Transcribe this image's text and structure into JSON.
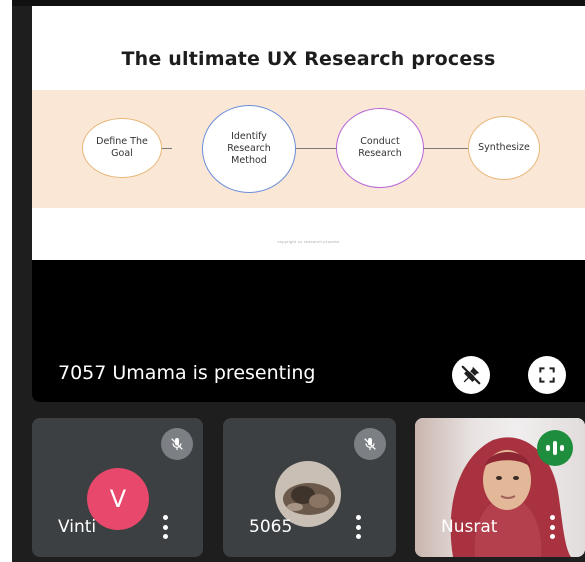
{
  "slide": {
    "title": "The ultimate UX Research process",
    "steps": [
      {
        "label": "Define The Goal",
        "color": "#e6b87a"
      },
      {
        "label": "Identify Research Method",
        "color": "#6a8fd8"
      },
      {
        "label": "Conduct Research",
        "color": "#b565d6"
      },
      {
        "label": "Synthesize",
        "color": "#e6b87a"
      }
    ],
    "footnote": "copyright ux research process"
  },
  "presenter": {
    "status_text": "7057 Umama is presenting"
  },
  "controls": {
    "unpin_icon": "pin-off-icon",
    "fullscreen_icon": "fullscreen-icon"
  },
  "participants": [
    {
      "name": "Vinti",
      "avatar_letter": "V",
      "avatar_color": "#e8486b",
      "muted": true
    },
    {
      "name": "5065",
      "avatar_type": "photo",
      "muted": true
    },
    {
      "name": "Nusrat",
      "avatar_type": "video",
      "speaking": true
    }
  ]
}
